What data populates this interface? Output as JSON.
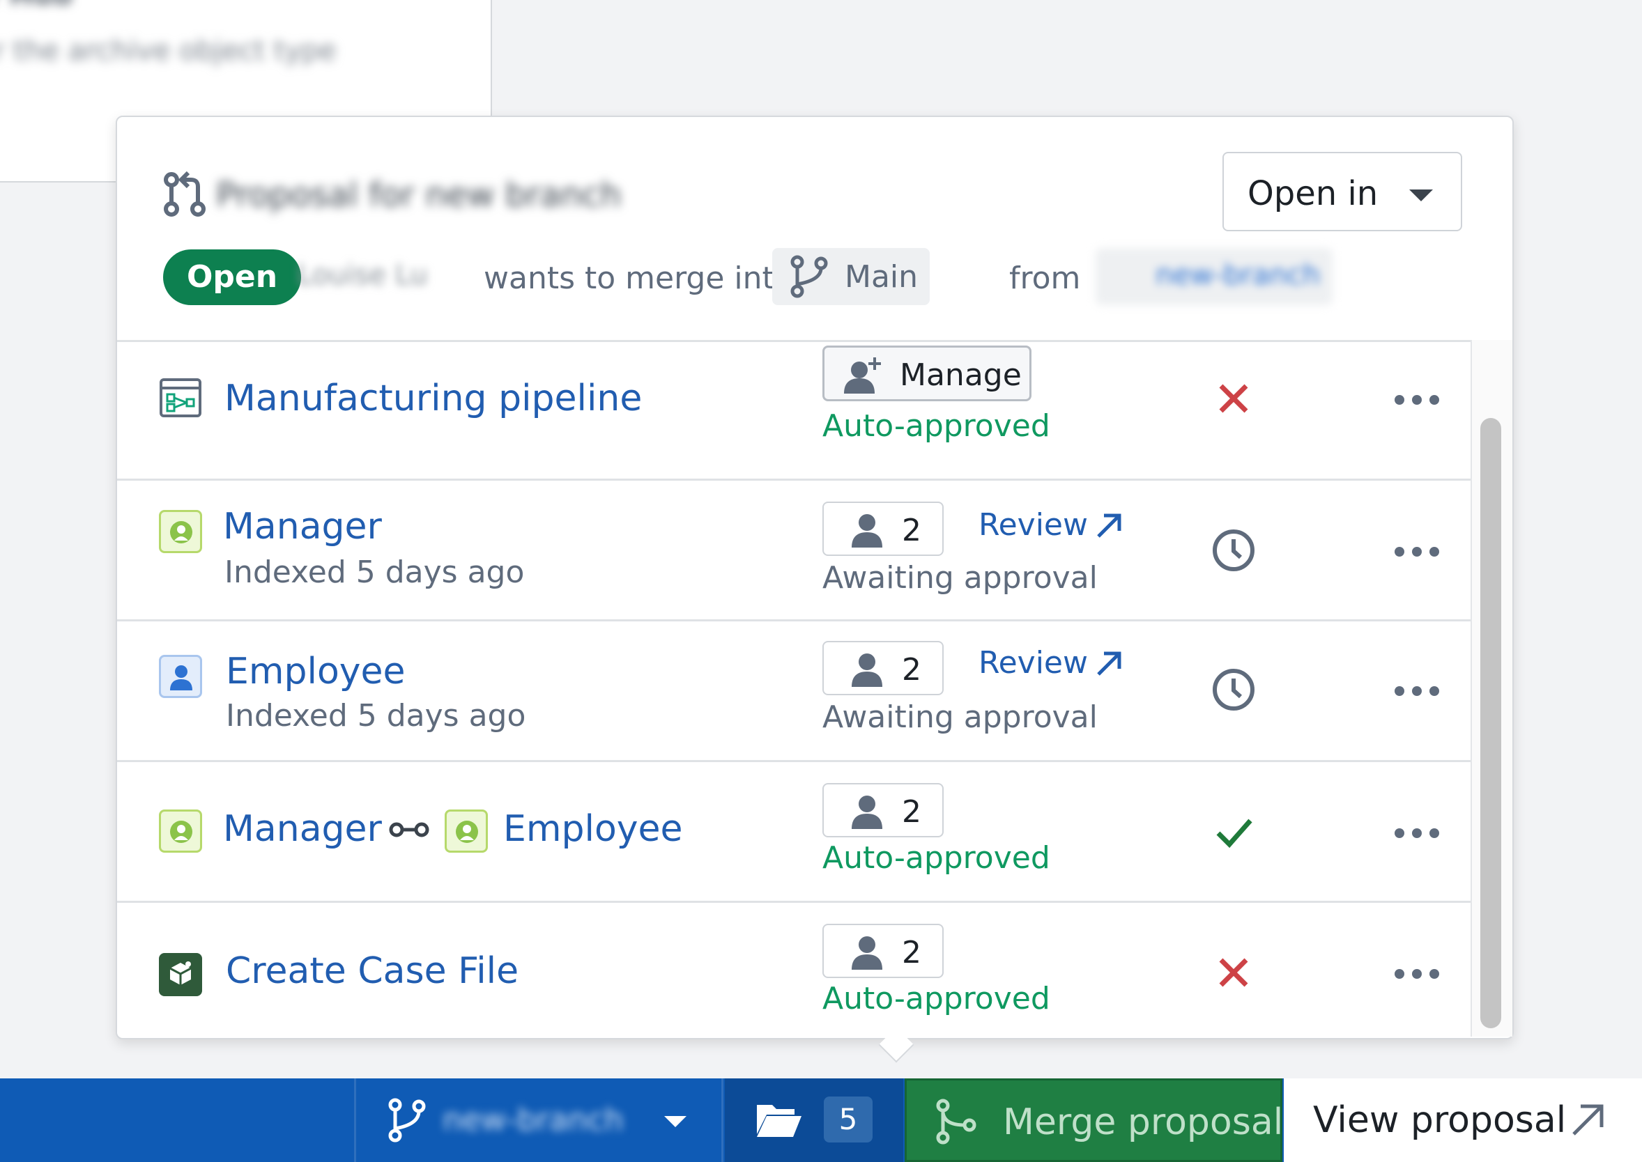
{
  "background": {
    "title": "r Hub",
    "text": "r the archive object type"
  },
  "popover": {
    "title": "Proposal for new branch",
    "open_in_label": "Open in",
    "status": "Open",
    "author": "Louise Lu",
    "wants_text": "wants to merge into",
    "target_branch": "Main",
    "from_text": "from",
    "source_branch": "new-branch"
  },
  "rows": [
    {
      "title": "Manufacturing pipeline",
      "icon": "pipeline-icon",
      "chip_label": "Manage",
      "state": "Auto-approved",
      "status": "rejected"
    },
    {
      "title": "Manager",
      "subtitle": "Indexed 5 days ago",
      "icon": "object-type-icon",
      "approvers": "2",
      "review_label": "Review",
      "state": "Awaiting approval",
      "status": "pending"
    },
    {
      "title": "Employee",
      "subtitle": "Indexed 5 days ago",
      "icon": "person-object-icon",
      "approvers": "2",
      "review_label": "Review",
      "state": "Awaiting approval",
      "status": "pending"
    },
    {
      "title": "Manager",
      "title2": "Employee",
      "icon": "link-type-icon",
      "approvers": "2",
      "state": "Auto-approved",
      "status": "approved"
    },
    {
      "title": "Create Case File",
      "icon": "action-type-icon",
      "approvers": "2",
      "state": "Auto-approved",
      "status": "rejected"
    }
  ],
  "bottom_bar": {
    "branch_name": "new-branch",
    "files_count": "5",
    "merge_label": "Merge proposal",
    "view_label": "View proposal"
  },
  "colors": {
    "link_blue": "#215db0",
    "open_green": "#0d8050",
    "approved_green": "#0f9960",
    "reject_red": "#cd4246",
    "bar_blue": "#0f5bb5",
    "merge_green": "#1f7f43"
  }
}
